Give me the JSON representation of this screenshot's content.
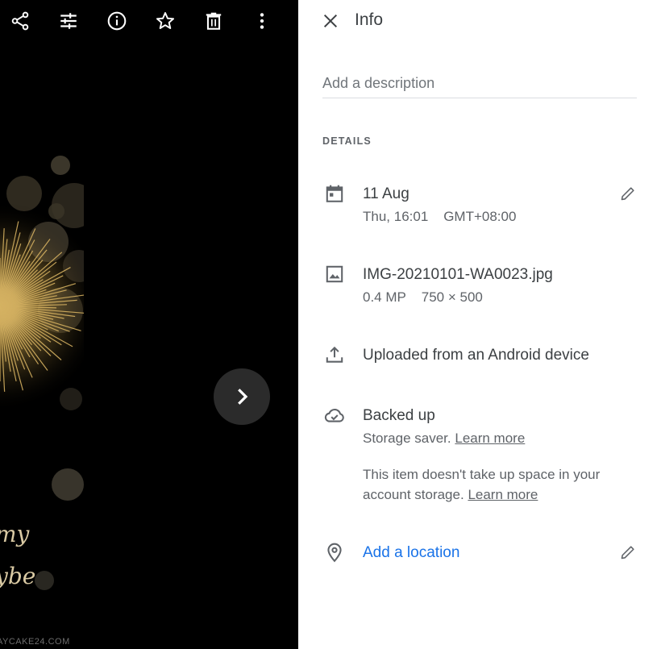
{
  "viewer": {
    "photo_script_line1": "my",
    "photo_script_line2": "ybe",
    "watermark": "AYCAKE24.COM",
    "toolbar_icons": [
      "share-icon",
      "edit-tune-icon",
      "info-icon",
      "star-icon",
      "delete-icon",
      "more-vert-icon"
    ],
    "next_icon": "chevron-right-icon"
  },
  "panel": {
    "title": "Info",
    "description_placeholder": "Add a description",
    "section_label": "DETAILS",
    "date": {
      "primary": "11 Aug",
      "day_time": "Thu, 16:01",
      "timezone": "GMT+08:00"
    },
    "file": {
      "name": "IMG-20210101-WA0023.jpg",
      "megapixels": "0.4 MP",
      "dimensions": "750 × 500"
    },
    "upload": {
      "text": "Uploaded from an Android device"
    },
    "backup": {
      "primary": "Backed up",
      "storage_text": "Storage saver.",
      "learn_more_1": "Learn more",
      "note_line1": "This item doesn't take up space in your",
      "note_line2": "account storage.",
      "learn_more_2": "Learn more"
    },
    "location": {
      "text": "Add a location"
    }
  },
  "colors": {
    "viewer_bg": "#000000",
    "panel_bg": "#ffffff",
    "text_primary": "#3c4043",
    "text_secondary": "#5f6368",
    "link_blue": "#1a73e8",
    "fireworks_gold": "#d4b060"
  }
}
